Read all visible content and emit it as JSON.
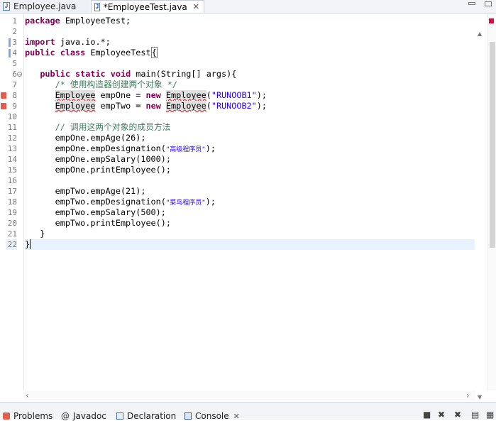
{
  "tabs": [
    {
      "label": "Employee.java"
    },
    {
      "label": "*EmployeeTest.java",
      "close": "✕"
    }
  ],
  "gutter": [
    "1",
    "2",
    "3",
    "4",
    "5",
    "6",
    "7",
    "8",
    "9",
    "10",
    "11",
    "12",
    "13",
    "14",
    "15",
    "16",
    "17",
    "18",
    "19",
    "20",
    "21",
    "22"
  ],
  "code": {
    "l1_kw": "package",
    "l1_rest": " EmployeeTest;",
    "l3_kw": "import",
    "l3_rest": " java.io.*;",
    "l4_kw1": "public",
    "l4_kw2": " class",
    "l4_rest": " EmployeeTest",
    "l6_indent": "   ",
    "l6_kw1": "public",
    "l6_kw2": " static",
    "l6_kw3": " void",
    "l6_rest": " main(String[] args){",
    "l7_comment": "      /* 使用构造器创建两个对象 */",
    "l8_indent": "      ",
    "l8_type": "Employee",
    "l8_mid": " empOne = ",
    "l8_new": "new",
    "l8_sp": " ",
    "l8_ctor": "Employee",
    "l8_open": "(",
    "l8_str": "\"RUNOOB1\"",
    "l8_close": ");",
    "l9_indent": "      ",
    "l9_type": "Employee",
    "l9_mid": " empTwo = ",
    "l9_new": "new",
    "l9_sp": " ",
    "l9_ctor": "Employee",
    "l9_open": "(",
    "l9_str": "\"RUNOOB2\"",
    "l9_close": ");",
    "l11_comment": "      // 调用这两个对象的成员方法",
    "l12": "      empOne.empAge(26);",
    "l13_pre": "      empOne.empDesignation(",
    "l13_str": "\"高级程序员\"",
    "l13_post": ");",
    "l14": "      empOne.empSalary(1000);",
    "l15": "      empOne.printEmployee();",
    "l17": "      empTwo.empAge(21);",
    "l18_pre": "      empTwo.empDesignation(",
    "l18_str": "\"菜鸟程序员\"",
    "l18_post": ");",
    "l19": "      empTwo.empSalary(500);",
    "l20": "      empTwo.printEmployee();",
    "l21": "   }",
    "l22": "}"
  },
  "bottom_tabs": [
    {
      "label": "Problems"
    },
    {
      "label": "Javadoc"
    },
    {
      "label": "Declaration"
    },
    {
      "label": "Console",
      "close": "✕"
    }
  ],
  "colors": {
    "keyword": "#7f0055",
    "comment": "#3f7f5f",
    "string": "#2a00ff",
    "error": "#e45b50"
  }
}
